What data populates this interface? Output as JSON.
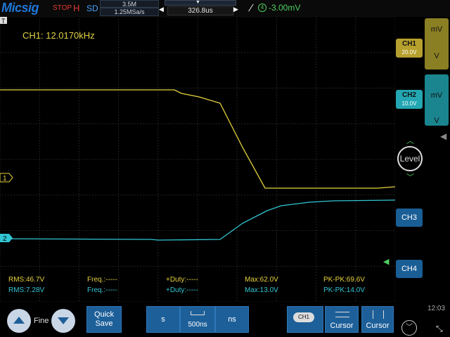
{
  "topbar": {
    "brand": "Micsig",
    "run_state": "STOP",
    "mode_flag": "H",
    "acq_mode": "SD",
    "memory_depth": "3.5M",
    "sample_rate": "1.25MSa/s",
    "time_offset": "326.8us",
    "trigger_channel": "4",
    "trigger_level": "-3.00mV"
  },
  "display": {
    "frequency_readout": "CH1: 12.0170kHz",
    "ch1_marker": "1",
    "ch2_marker": "2",
    "colors": {
      "ch1": "#e6d23d",
      "ch2": "#31c6d4",
      "trigger": "#4fd160",
      "grid": "#3b3b3b"
    }
  },
  "measurements": {
    "ch1": {
      "rms": "RMS:46.7V",
      "freq": "Freq.:-----",
      "duty": "+Duty:-----",
      "max": "Max:62.0V",
      "pkpk": "PK-PK:69.6V"
    },
    "ch2": {
      "rms": "RMS:7.28V",
      "freq": "Freq.:-----",
      "duty": "+Duty:-----",
      "max": "Max:13.0V",
      "pkpk": "PK-PK:14.0V"
    }
  },
  "right_panel": {
    "ch1": {
      "label": "CH1",
      "scale": "20.0V"
    },
    "ch2": {
      "label": "CH2",
      "scale": "10.0V"
    },
    "ch3": {
      "label": "CH3"
    },
    "ch4": {
      "label": "CH4"
    },
    "ch1_units": {
      "top": "mV",
      "bottom": "V"
    },
    "ch2_units": {
      "top": "mV",
      "bottom": "V"
    },
    "level_label": "Level"
  },
  "bottombar": {
    "fine_label": "Fine",
    "quick_save_line1": "Quick",
    "quick_save_line2": "Save",
    "unit_left": "s",
    "timebase": "500ns",
    "unit_right": "ns",
    "channel_pill": "CH1",
    "cursor1_label": "Cursor",
    "cursor2_label": "Cursor",
    "clock": "12:03"
  },
  "chart_data": {
    "type": "line",
    "grid": true,
    "series": [
      {
        "name": "CH1",
        "color": "#e6d23d",
        "points": [
          [
            0,
            128
          ],
          [
            248,
            128
          ],
          [
            258,
            133
          ],
          [
            283,
            138
          ],
          [
            313,
            147
          ],
          [
            345,
            210
          ],
          [
            377,
            268
          ],
          [
            537,
            268
          ],
          [
            562,
            266
          ]
        ]
      },
      {
        "name": "CH2",
        "color": "#31c6d4",
        "points": [
          [
            0,
            340
          ],
          [
            215,
            341
          ],
          [
            225,
            342
          ],
          [
            313,
            341
          ],
          [
            345,
            318
          ],
          [
            380,
            300
          ],
          [
            400,
            293
          ],
          [
            440,
            288
          ],
          [
            475,
            286
          ],
          [
            562,
            285
          ]
        ]
      }
    ]
  }
}
